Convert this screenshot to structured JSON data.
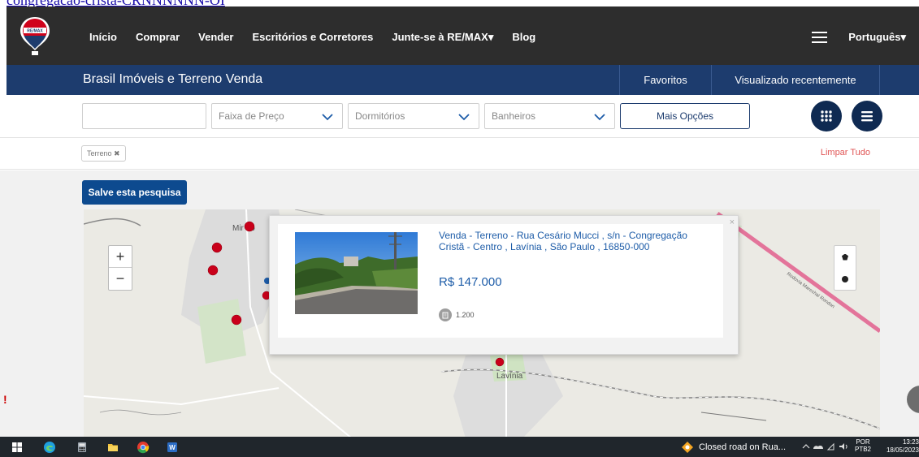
{
  "browser": {
    "top_link": "congregacao-cristã-CRNNNNNN-OI"
  },
  "nav": {
    "items": [
      "Início",
      "Comprar",
      "Vender",
      "Escritórios e Corretores",
      "Junte-se à RE/MAX▾",
      "Blog"
    ],
    "language": "Português▾",
    "logo_text": "RE/MAX"
  },
  "subbar": {
    "title": "Brasil Imóveis e Terreno Venda",
    "favorites": "Favoritos",
    "recent": "Visualizado recentemente"
  },
  "filters": {
    "search_value": "",
    "price": "Faixa de Preço",
    "bedrooms": "Dormitórios",
    "bathrooms": "Banheiros",
    "more": "Mais Opções"
  },
  "tags": {
    "items": [
      "Terreno ✖"
    ],
    "clear_all": "Limpar Tudo"
  },
  "save_search": "Salve esta pesquisa",
  "map": {
    "zoom_in": "+",
    "zoom_out": "−",
    "towns": [
      "Mir    do",
      "Lavínia"
    ],
    "road_label": "Rodovia Marechal Rondon"
  },
  "popup": {
    "title": "Venda - Terreno - Rua Cesário Mucci , s/n - Congregação Cristã - Centro , Lavínia , São Paulo , 16850-000",
    "price": "R$ 147.000",
    "area": "1.200",
    "close": "×"
  },
  "taskbar": {
    "notification": "Closed road on Rua...",
    "lang_top": "POR",
    "lang_bottom": "PTB2",
    "time": "13:23",
    "date": "18/05/2023"
  },
  "colors": {
    "nav_bg": "#2d2d2d",
    "subbar_bg": "#1d3c6e",
    "accent": "#0d4a8f",
    "marker": "#d0021b",
    "clear": "#e05555"
  }
}
